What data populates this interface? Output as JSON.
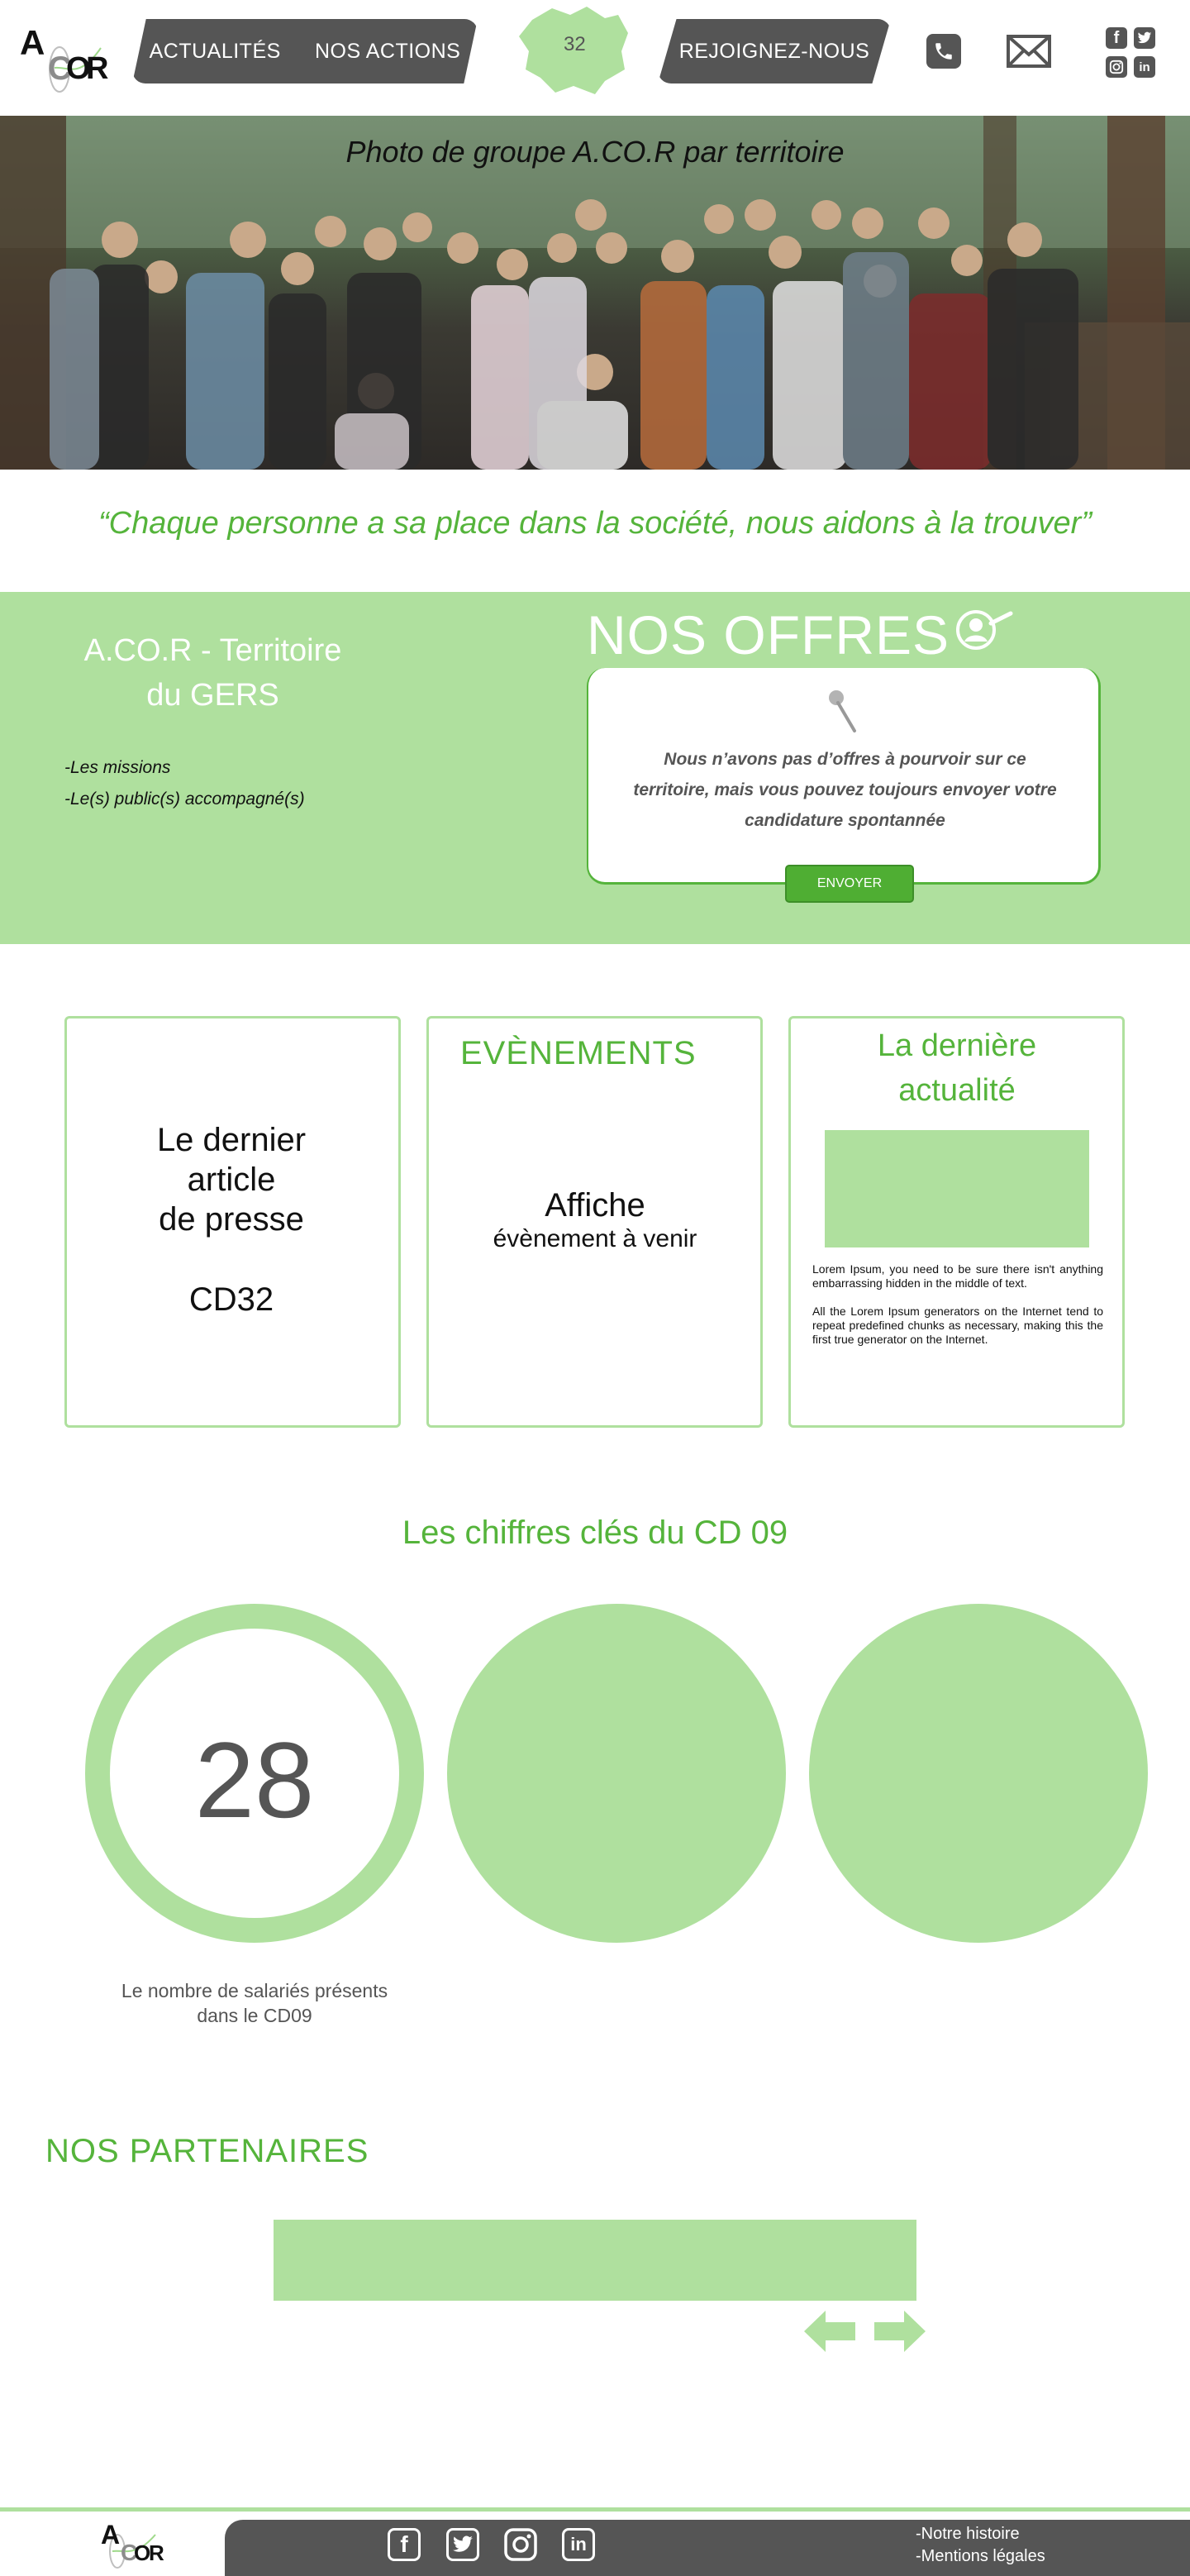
{
  "header": {
    "logo_letters": [
      "A",
      "C",
      "O",
      "R"
    ],
    "nav_left": [
      "ACTUALITÉS",
      "NOS ACTIONS"
    ],
    "department_number": "32",
    "nav_right": "REJOIGNEZ-NOUS",
    "icons": [
      "phone-icon",
      "mail-icon",
      "facebook-icon",
      "twitter-icon",
      "instagram-icon",
      "linkedin-icon"
    ]
  },
  "hero": {
    "title": "Photo de groupe A.CO.R par territoire"
  },
  "quote": "“Chaque personne a sa place dans la société, nous aidons à la trouver”",
  "territory": {
    "title_line1": "A.CO.R - Territoire",
    "title_line2": "du GERS",
    "items": [
      "-Les missions",
      "-Le(s) public(s) accompagné(s)"
    ]
  },
  "offers": {
    "title": "NOS OFFRES",
    "text": "Nous n’avons pas d’offres à pourvoir sur ce territoire, mais vous pouvez toujours envoyer votre candidature spontannée",
    "button_label": "ENVOYER"
  },
  "cards": {
    "press_line1": "Le dernier",
    "press_line2": "article",
    "press_line3": "de presse",
    "press_code": "CD32",
    "events_title": "EVÈNEMENTS",
    "events_affiche": "Affiche",
    "events_sub": "évènement à venir",
    "news_title_line1": "La dernière",
    "news_title_line2": "actualité",
    "news_p1": "Lorem Ipsum, you need to be sure there isn't anything embarrassing hidden in the middle of text.",
    "news_p2": "All the Lorem Ipsum generators on the Internet tend to repeat predefined chunks as necessary, making this the first true generator on the Internet."
  },
  "kpi": {
    "title": "Les chiffres clés du CD 09",
    "value": "28",
    "label_line1": "Le nombre de salariés présents",
    "label_line2": "dans le CD09"
  },
  "partners": {
    "title": "NOS PARTENAIRES"
  },
  "footer": {
    "links": [
      "-Notre histoire",
      "-Mentions légales"
    ]
  },
  "colors": {
    "accent_green": "#55b43b",
    "light_green": "#afe09e",
    "dark_grey": "#555555"
  }
}
